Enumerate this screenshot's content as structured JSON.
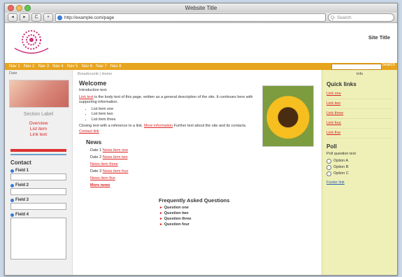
{
  "window": {
    "title": "Website Title"
  },
  "toolbar": {
    "back": "◂",
    "forward": "▸",
    "reload": "C",
    "add": "+",
    "url": "http://example.com/page",
    "google_placeholder": "Q- Search"
  },
  "site": {
    "title": "Site Title"
  },
  "nav": {
    "items": [
      "Nav 1",
      "Nav 2",
      "Nav 3",
      "Nav 4",
      "Nav 5",
      "Nav 6",
      "Nav 7",
      "Nav 8"
    ],
    "search_button": "Search"
  },
  "left": {
    "date": "Date",
    "zorg": "Section Label",
    "overzicht_1": "Overview",
    "overzicht_2": "List item",
    "overzicht_3": "Link text",
    "contact": "Contact",
    "labels": [
      "Field 1",
      "Field 2",
      "Field 3",
      "Field 4"
    ]
  },
  "center": {
    "crumbs": [
      "Breadcrumb",
      "Home"
    ],
    "heading": "Welcome",
    "intro_1": "Introduction text.",
    "intro_2a": "Link text",
    "intro_2b": " is the body text of this page, written as a general description of the site. It continues here with supporting information.",
    "bullets": [
      "List item one",
      "List item two",
      "List item three"
    ],
    "closing_a": "Closing text with a reference to a link. ",
    "closing_link": "More information",
    "closing_b": "Further text about the site and its contacts. ",
    "closing_link2": "Contact link",
    "actueel": "News",
    "news": [
      {
        "date": "Date 1",
        "title": "News item one",
        "bold": false
      },
      {
        "date": "Date 2",
        "title": "News item two",
        "bold": false
      },
      {
        "date": "",
        "title": "News item three",
        "bold": false
      },
      {
        "date": "Date 3",
        "title": "News item four",
        "bold": false
      },
      {
        "date": "",
        "title": "News item five",
        "bold": false
      },
      {
        "date": "",
        "title": "More news",
        "bold": true
      }
    ],
    "faq_heading": "Frequently Asked Questions",
    "faq": [
      "Question one",
      "Question two",
      "Question three",
      "Question four"
    ]
  },
  "right": {
    "beheer": "Info",
    "snel_naar": "Quick links",
    "quick_links": [
      "Link one",
      "Link two",
      "Link three",
      "Link four",
      "Link five"
    ],
    "enquete": "Poll",
    "enquete_q": "Poll question text",
    "options": [
      "Option A",
      "Option B",
      "Option C"
    ],
    "footer_links": "Footer link"
  }
}
